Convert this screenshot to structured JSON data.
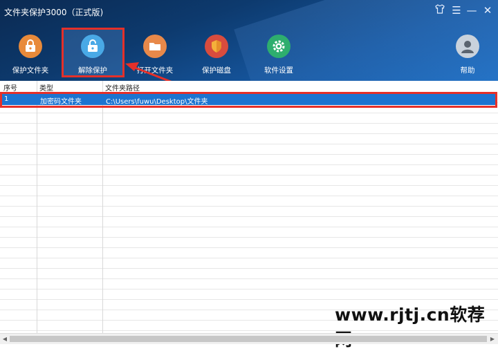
{
  "app": {
    "title": "文件夹保护3000（正式版)"
  },
  "window_controls": {
    "skin": "♡",
    "menu": "☰",
    "minimize": "—",
    "close": "✕"
  },
  "toolbar": {
    "protect_folder": "保护文件夹",
    "remove_protection": "解除保护",
    "open_folder": "打开文件夹",
    "protect_disk": "保护磁盘",
    "settings": "软件设置",
    "help": "帮助"
  },
  "table": {
    "headers": [
      "序号",
      "类型",
      "文件夹路径"
    ],
    "rows": [
      {
        "index": "1",
        "type": "加密码文件夹",
        "path": "C:\\Users\\fuwu\\Desktop\\文件夹"
      }
    ]
  },
  "watermark": "www.rjtj.cn软荐网",
  "colors": {
    "header_dark": "#0b2a52",
    "selection": "#1c74d0",
    "annotation_red": "#e53029"
  }
}
